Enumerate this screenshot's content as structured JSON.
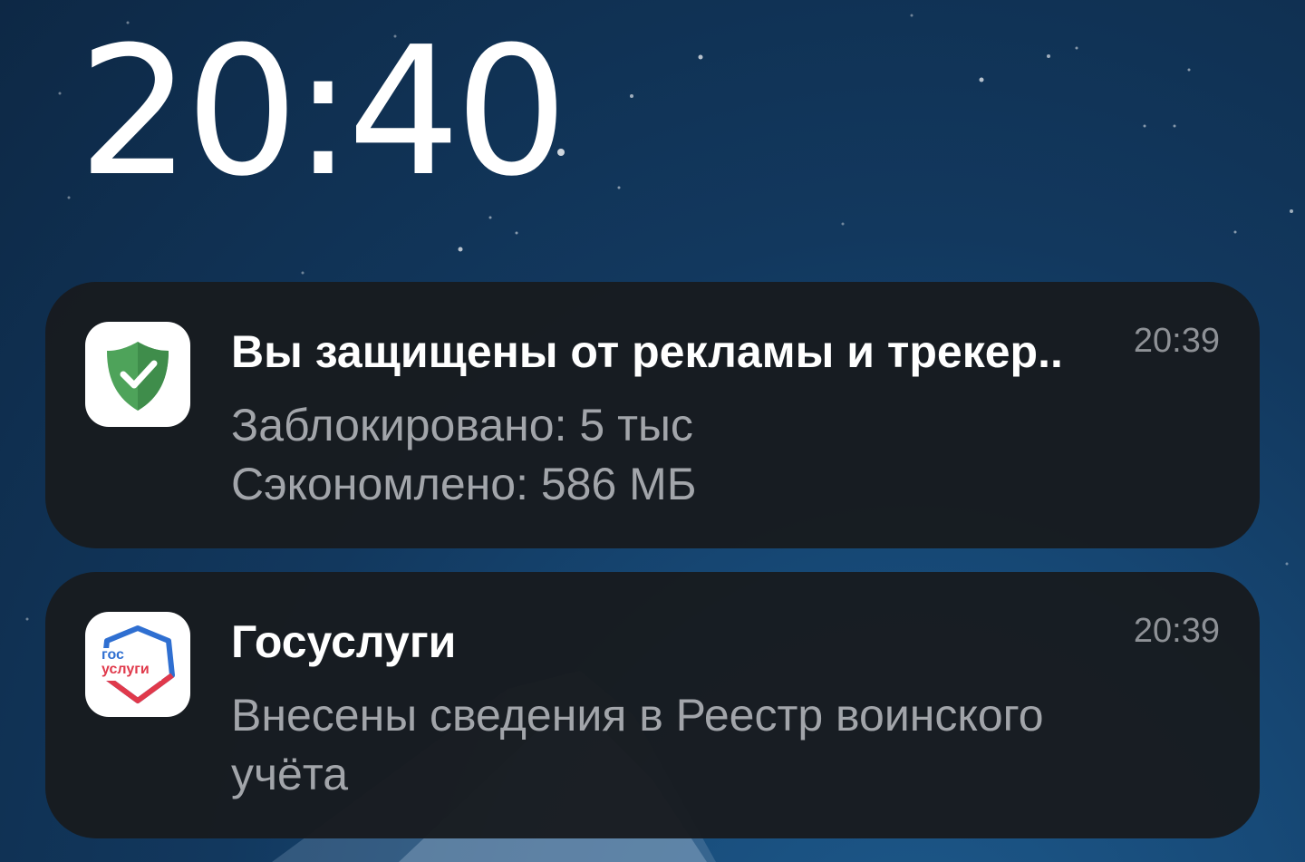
{
  "lockscreen": {
    "clock": "20:40"
  },
  "notifications": [
    {
      "app_icon": "adguard-shield-icon",
      "title": "Вы защищены от рекламы и трекер..",
      "time": "20:39",
      "lines": [
        "Заблокировано: 5 тыс",
        "Сэкономлено: 586 МБ"
      ]
    },
    {
      "app_icon": "gosuslugi-logo-icon",
      "title": "Госуслуги",
      "time": "20:39",
      "lines": [
        "Внесены сведения в Реестр воинского",
        "учёта"
      ],
      "icon_text": [
        "гос",
        "услуги"
      ]
    }
  ],
  "colors": {
    "card_background": "#181b1f",
    "title_text": "#ffffff",
    "body_text": "#a2a5aa",
    "time_text": "#8e9196",
    "shield_green": "#4ea35a",
    "gos_blue": "#2f6fd1",
    "gos_red": "#e0394b"
  }
}
